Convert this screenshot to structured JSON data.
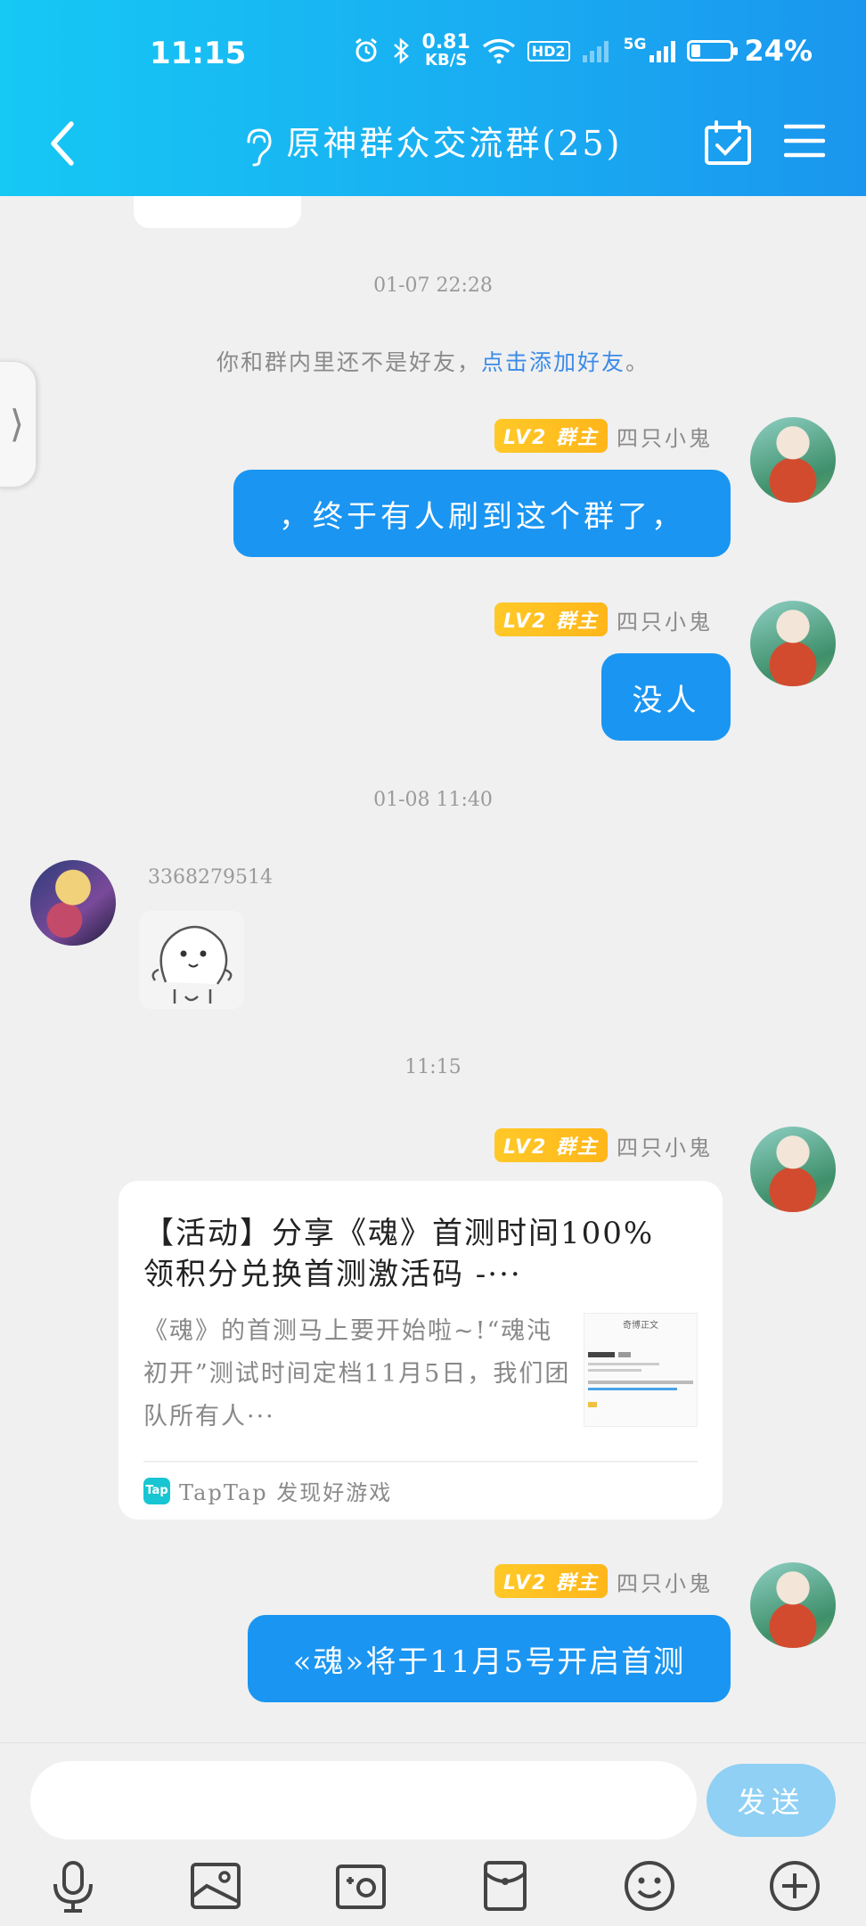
{
  "status_bar": {
    "time": "11:15",
    "net_speed_value": "0.81",
    "net_speed_unit": "KB/S",
    "hd_label": "HD2",
    "signal_label": "5G",
    "battery_percent": "24%",
    "battery_level": 0.24
  },
  "header": {
    "title": "原神群众交流群(25)"
  },
  "chat": {
    "timestamps": [
      "01-07 22:28",
      "01-08 11:40",
      "11:15"
    ],
    "system_notice": {
      "text": "你和群内里还不是好友，",
      "link": "点击添加好友",
      "suffix": "。"
    },
    "owner": {
      "badge": "LV2 群主",
      "name": "四只小鬼"
    },
    "messages": [
      {
        "text": "，终于有人刷到这个群了，"
      },
      {
        "text": "没人"
      },
      {
        "text": "«魂»将于11月5号开启首测"
      }
    ],
    "other_user": {
      "name": "3368279514"
    },
    "share_card": {
      "title": "【活动】分享《魂》首测时间100%领积分兑换首测激活码 -···",
      "description": "《魂》的首测马上要开始啦~!“魂沌初开”测试时间定档11月5日，我们团队所有人···",
      "thumb_title": "奇博正文",
      "source": "TapTap 发现好游戏",
      "source_logo": "Tap"
    }
  },
  "input_bar": {
    "placeholder": "",
    "send_label": "发送"
  },
  "colors": {
    "header_start": "#16c8f4",
    "header_end": "#1a96ee",
    "bubble": "#1a95f2",
    "badge": "#ffc928",
    "send": "#8fd0f4",
    "link": "#3b8be8"
  }
}
